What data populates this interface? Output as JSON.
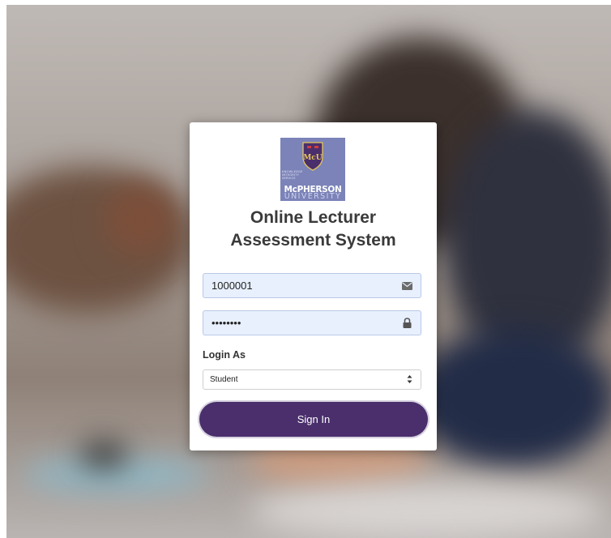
{
  "brand": {
    "logo_monogram": "McU",
    "logo_motto": [
      "KNOWLEDGE",
      "INTEGRITY",
      "SERVICE"
    ],
    "logo_name_top": "McPHERSON",
    "logo_name_bottom": "UNIVERSITY",
    "accent": "#4a2f6c",
    "logo_bg": "#7b83b8"
  },
  "title_line1": "Online Lecturer",
  "title_line2": "Assessment System",
  "form": {
    "username_value": "1000001",
    "username_icon": "envelope-icon",
    "password_value": "password",
    "password_icon": "lock-icon",
    "login_as_label": "Login As",
    "login_as_selected": "Student",
    "submit_label": "Sign In"
  }
}
